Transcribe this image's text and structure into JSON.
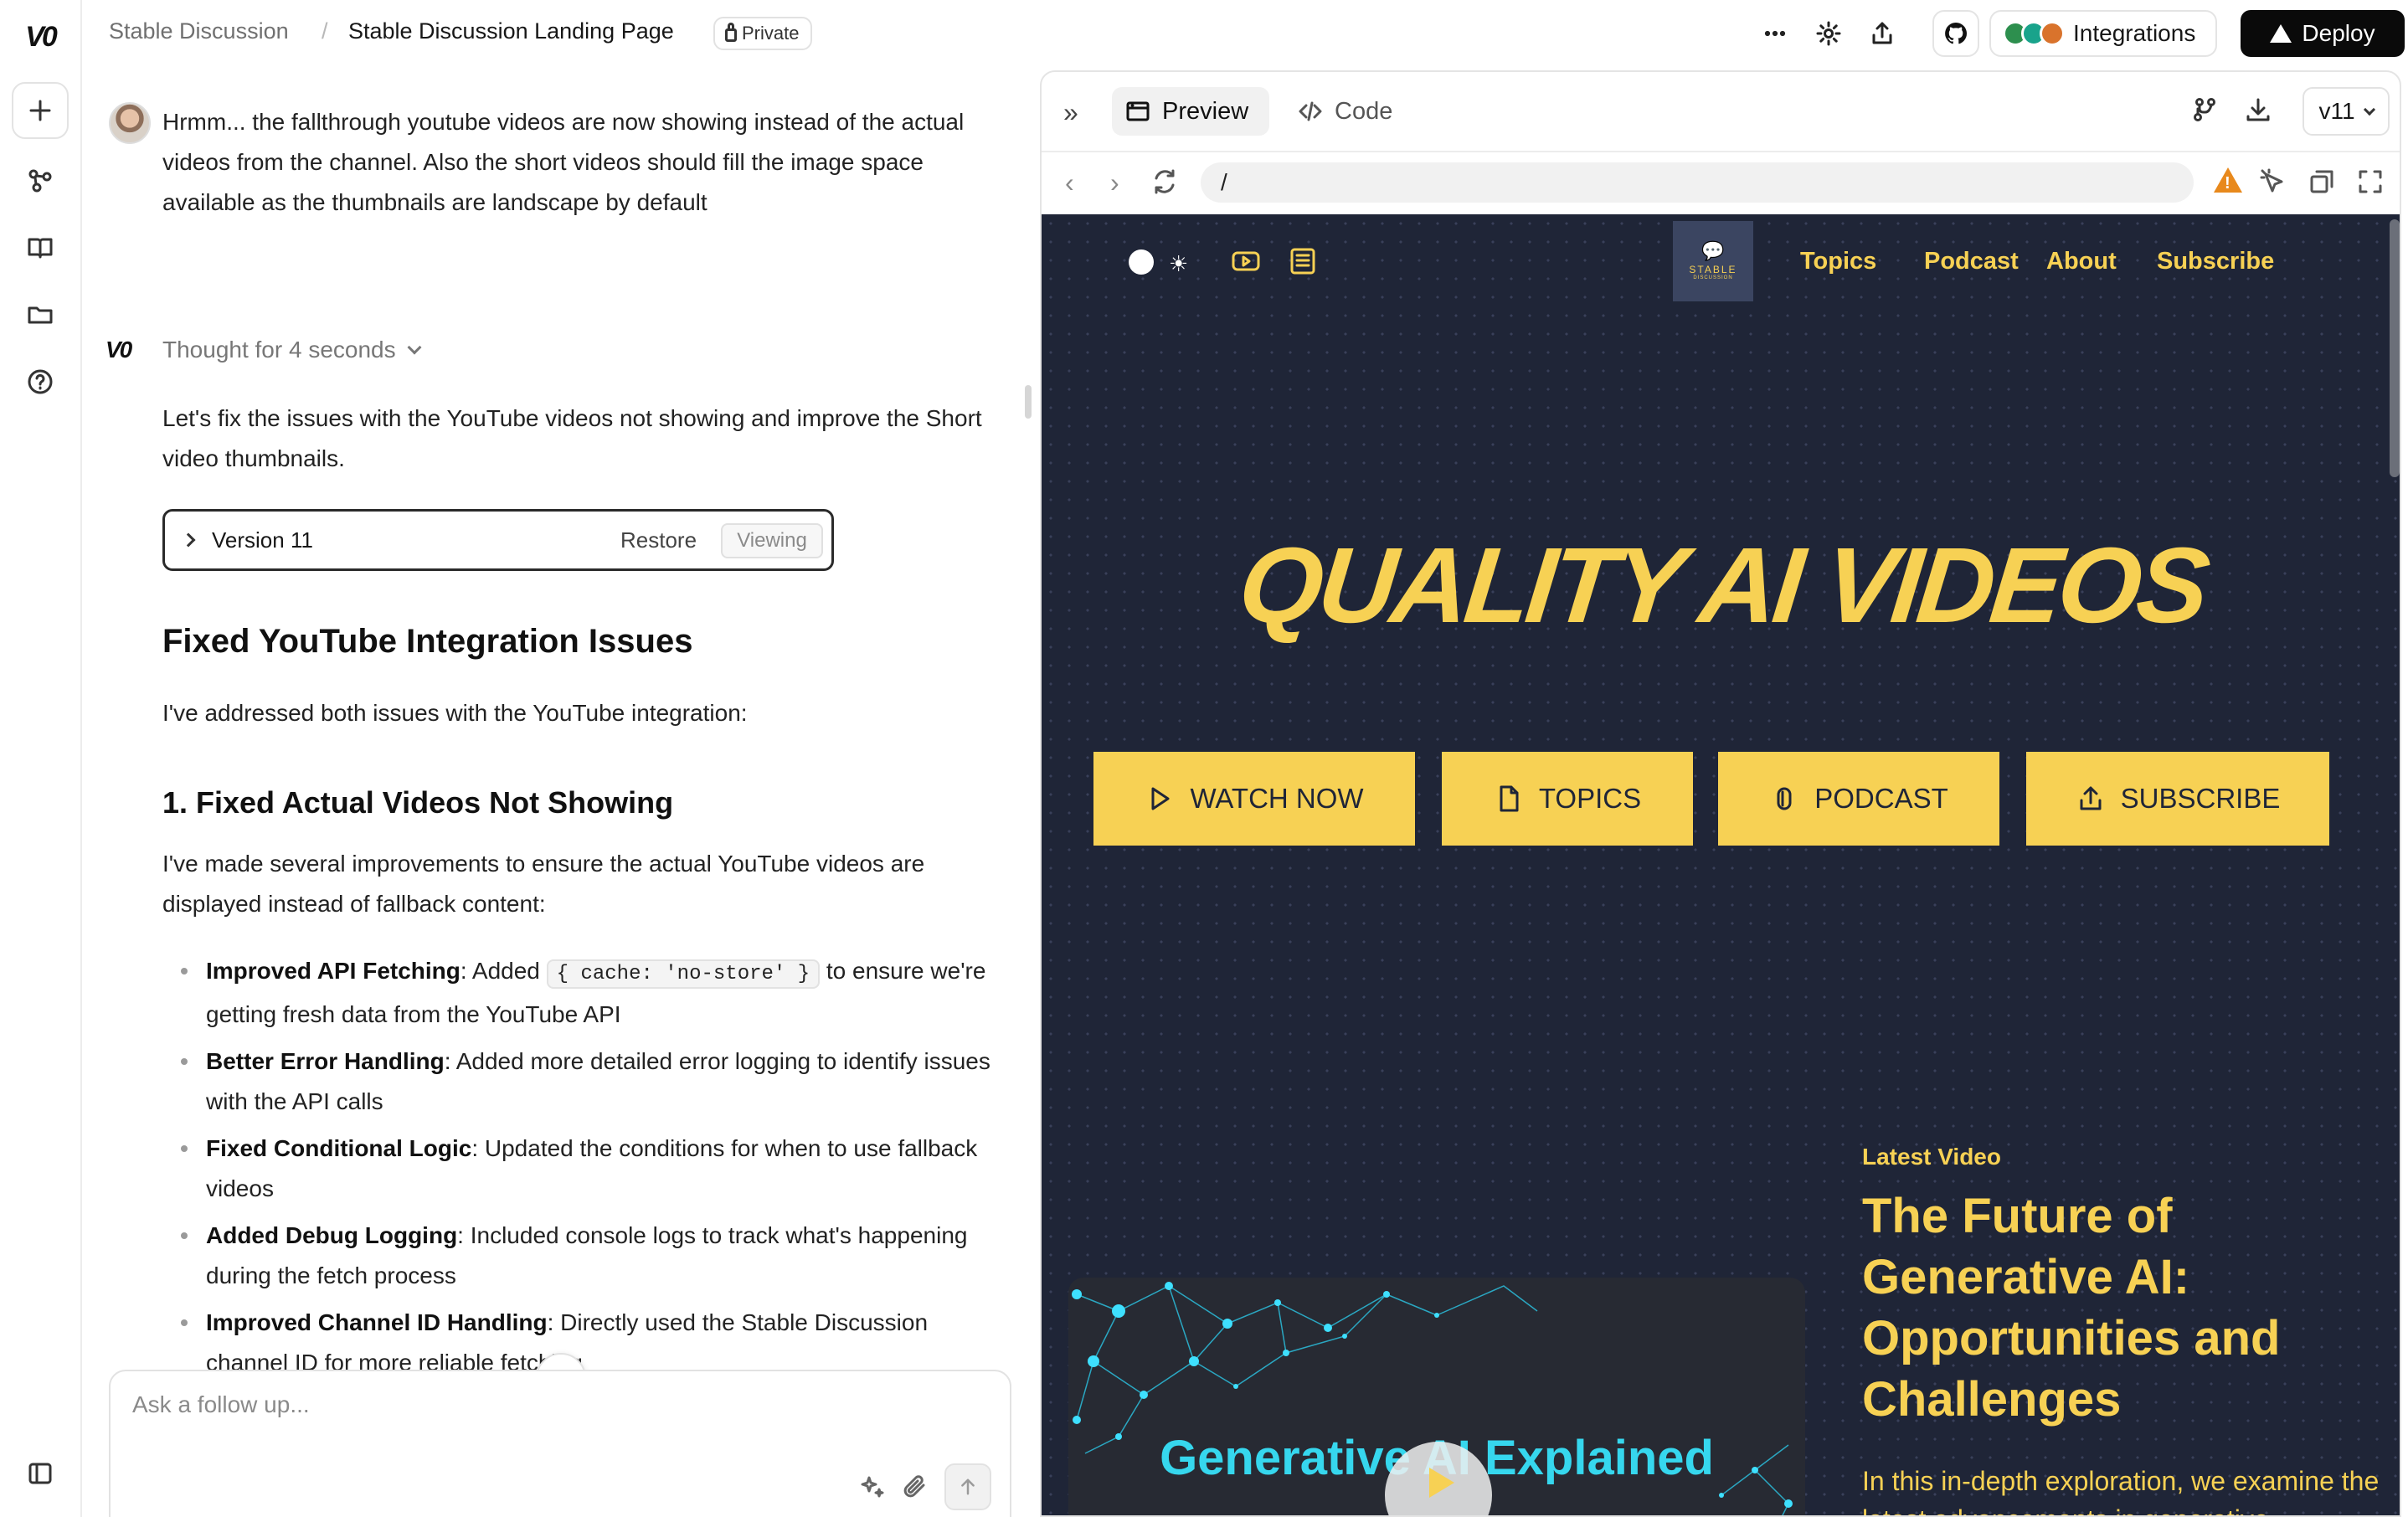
{
  "app": {
    "logo": "V0",
    "breadcrumb": {
      "project": "Stable Discussion",
      "separator": "/",
      "page": "Stable Discussion Landing Page"
    },
    "visibility": "Private",
    "integrations_label": "Integrations",
    "integration_colors": [
      "#2d8f4e",
      "#19a38b",
      "#d9732c"
    ],
    "deploy_label": "Deploy"
  },
  "rail": {
    "items": [
      "new-chat",
      "projects",
      "docs",
      "files",
      "help",
      "sidebar-toggle"
    ]
  },
  "chat": {
    "user_message": "Hrmm... the fallthrough youtube videos are now showing instead of the actual videos from the channel. Also the short videos should fill the image space available as the thumbnails are landscape by default",
    "thought_label": "Thought for 4 seconds",
    "assistant_intro": "Let's fix the issues with the YouTube videos not showing and improve the Short video thumbnails.",
    "version_card": {
      "label": "Version 11",
      "restore_label": "Restore",
      "viewing_label": "Viewing"
    },
    "heading": "Fixed YouTube Integration Issues",
    "summary": "I've addressed both issues with the YouTube integration:",
    "subheading": "1. Fixed Actual Videos Not Showing",
    "subheading_text": "I've made several improvements to ensure the actual YouTube videos are displayed instead of fallback content:",
    "bullets": [
      {
        "title": "Improved API Fetching",
        "pre": ": Added ",
        "code": "{ cache: 'no-store' }",
        "post": " to ensure we're getting fresh data from the YouTube API"
      },
      {
        "title": "Better Error Handling",
        "text": ": Added more detailed error logging to identify issues with the API calls"
      },
      {
        "title": "Fixed Conditional Logic",
        "text": ": Updated the conditions for when to use fallback videos"
      },
      {
        "title": "Added Debug Logging",
        "text": ": Included console logs to track what's happening during the fetch process"
      },
      {
        "title": "Improved Channel ID Handling",
        "text": ": Directly used the Stable Discussion channel ID for more reliable fetching"
      }
    ],
    "composer_placeholder": "Ask a follow up..."
  },
  "preview": {
    "tabs": {
      "preview": "Preview",
      "code": "Code"
    },
    "version_select": "v11",
    "url": "/",
    "site": {
      "colors": {
        "background": "#1f2537",
        "accent": "#f7d154",
        "thumb_title": "#36d7ee"
      },
      "logo_line1": "STABLE",
      "logo_line2": "DISCUSSION",
      "nav": [
        "Topics",
        "Podcast",
        "About",
        "Subscribe"
      ],
      "hero_title": "QUALITY AI VIDEOS",
      "buttons": [
        "WATCH NOW",
        "TOPICS",
        "PODCAST",
        "SUBSCRIBE"
      ],
      "thumbnail_title": "Generative AI Explained",
      "latest_kicker": "Latest Video",
      "latest_title": "The Future of Generative AI: Opportunities and Challenges",
      "latest_desc": "In this in-depth exploration, we examine the latest advancements in generative"
    }
  }
}
